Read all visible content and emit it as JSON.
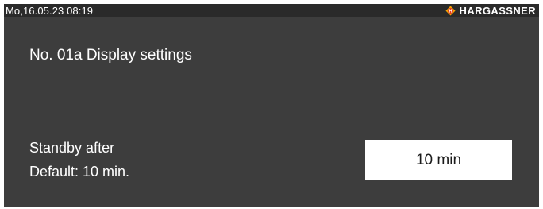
{
  "status_bar": {
    "datetime": "Mo,16.05.23 08:19",
    "brand_icon": "hargassner-logo-icon",
    "brand_name": "HARGASSNER",
    "brand_icon_color": "#f5a300"
  },
  "screen": {
    "title": "No. 01a Display settings",
    "setting": {
      "label": "Standby after",
      "default": "Default: 10 min.",
      "value": "10 min"
    }
  },
  "colors": {
    "top_bar": "#2a2a2a",
    "background": "#3d3d3d",
    "text": "#ffffff",
    "value_field": "#ffffff"
  }
}
